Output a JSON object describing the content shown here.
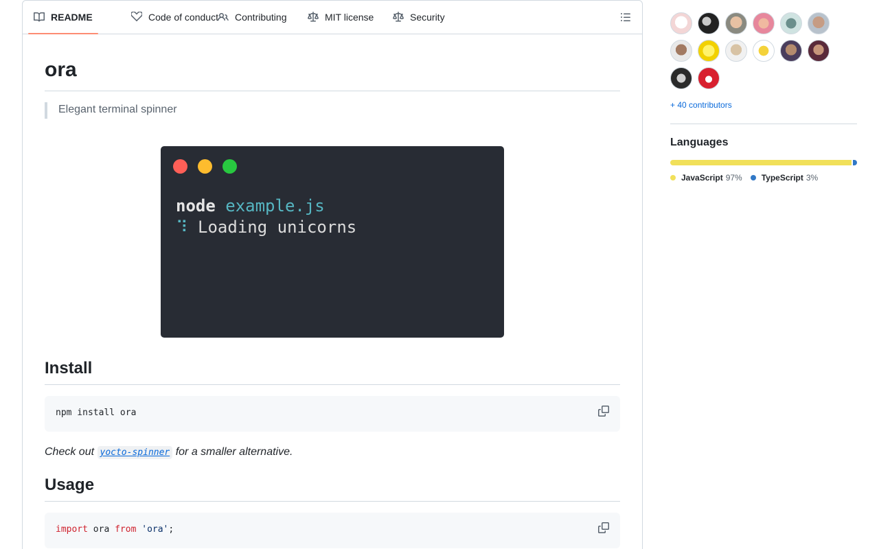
{
  "tabs": [
    {
      "label": "README",
      "icon": "book-icon",
      "active": true
    },
    {
      "label": "Code of conduct",
      "icon": "code-of-conduct-icon"
    },
    {
      "label": "Contributing",
      "icon": "people-icon"
    },
    {
      "label": "MIT license",
      "icon": "law-icon"
    },
    {
      "label": "Security",
      "icon": "law-icon"
    }
  ],
  "readme": {
    "title": "ora",
    "tagline": "Elegant terminal spinner",
    "terminal": {
      "command": "node",
      "argument": "example.js",
      "spinner_glyph": "⠹",
      "loading_text": "Loading unicorns",
      "dot_colors": [
        "#ff5f57",
        "#febc2e",
        "#28c840"
      ]
    },
    "install_heading": "Install",
    "install_code": "npm install ora",
    "note_prefix": "Check out",
    "note_link": "yocto-spinner",
    "note_suffix": "for a smaller alternative.",
    "usage_heading": "Usage",
    "usage_code": {
      "kw1": "import",
      "name": "ora",
      "kw2": "from",
      "module": "'ora'",
      "end": ";"
    }
  },
  "sidebar": {
    "more_contributors": "+ 40 contributors",
    "languages_title": "Languages",
    "languages": [
      {
        "name": "JavaScript",
        "percent": "97%",
        "share": 97,
        "color": "#f1e05a"
      },
      {
        "name": "TypeScript",
        "percent": "3%",
        "share": 3,
        "color": "#3178c6"
      }
    ]
  },
  "colors": {
    "accent_tab_underline": "#fd8c73",
    "link": "#0969da",
    "terminal_bg": "#282c34"
  }
}
